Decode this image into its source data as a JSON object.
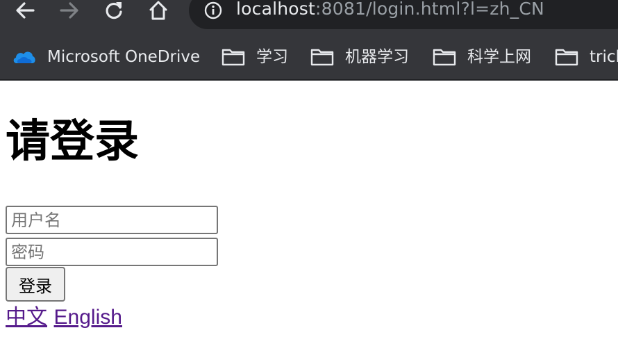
{
  "browser": {
    "url_host": "localhost",
    "url_rest": ":8081/login.html?l=zh_CN",
    "bookmarks": [
      {
        "label": "Microsoft OneDrive",
        "icon": "onedrive-icon"
      },
      {
        "label": "学习",
        "icon": "folder-icon"
      },
      {
        "label": "机器学习",
        "icon": "folder-icon"
      },
      {
        "label": "科学上网",
        "icon": "folder-icon"
      },
      {
        "label": "tricl",
        "icon": "folder-icon"
      }
    ]
  },
  "page": {
    "title": "请登录",
    "username_placeholder": "用户名",
    "password_placeholder": "密码",
    "login_label": "登录",
    "lang_links": [
      "中文",
      "English"
    ]
  },
  "colors": {
    "chrome_bg": "#35363a",
    "omnibox_bg": "#202124",
    "link_visited": "#551a8b"
  }
}
